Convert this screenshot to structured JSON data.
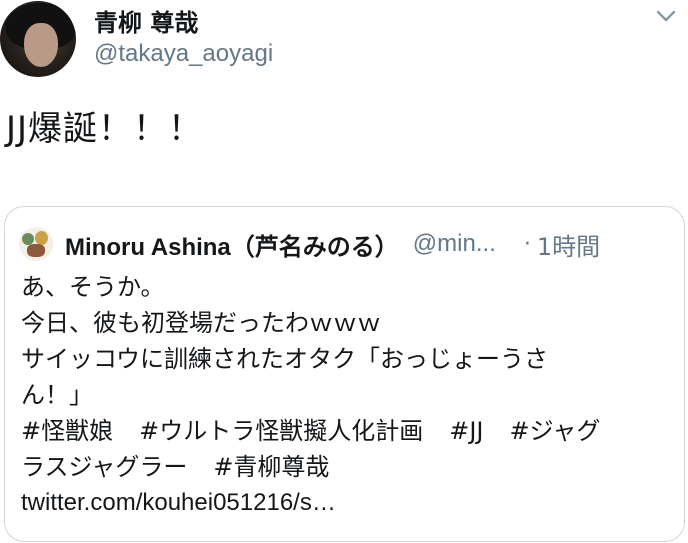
{
  "author": {
    "name": "青柳 尊哉",
    "handle": "@takaya_aoyagi"
  },
  "tweet": {
    "text": "JJ爆誕！！！"
  },
  "icons": {
    "more": "chevron-down-icon"
  },
  "colors": {
    "text": "#14171a",
    "secondary": "#657786",
    "border": "#ccd6dd"
  },
  "quoted_tweet": {
    "name": "Minoru Ashina（芦名みのる）",
    "handle": "@min...",
    "separator": "·",
    "time": "1時間",
    "lines": [
      "あ、そうか。",
      "今日、彼も初登場だったわｗｗｗ",
      "サイッコウに訓練されたオタク「おっじょーうさ",
      "ん！」"
    ],
    "hashtags_line1": [
      "#怪獣娘",
      "#ウルトラ怪獣擬人化計画",
      "#JJ",
      "#ジャグ"
    ],
    "hashtags_line2": [
      "ラスジャグラー",
      "#青柳尊哉"
    ],
    "link": "twitter.com/kouhei051216/s…"
  }
}
